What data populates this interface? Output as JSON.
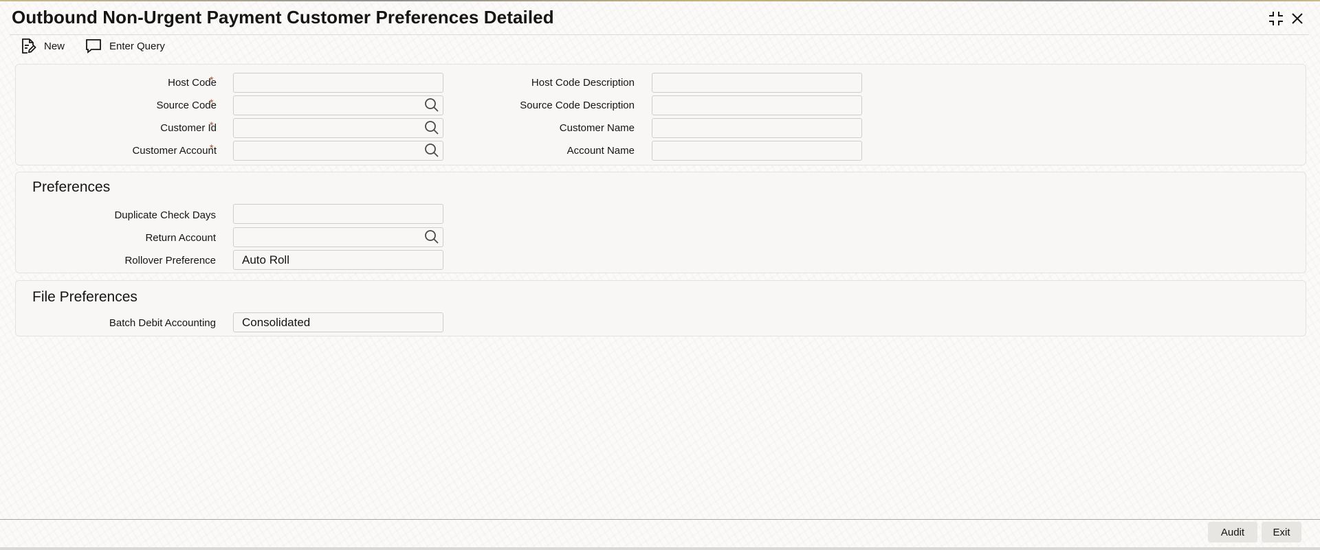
{
  "window": {
    "title": "Outbound Non-Urgent Payment Customer Preferences Detailed",
    "maximize_icon": "expand-corners-icon",
    "close_icon": "close-icon"
  },
  "toolbar": {
    "new_label": "New",
    "new_icon": "new-document-icon",
    "query_label": "Enter Query",
    "query_icon": "speech-bubble-icon"
  },
  "header_section": {
    "required_marker": "*",
    "host_code": {
      "label": "Host Code",
      "value": ""
    },
    "host_code_description": {
      "label": "Host Code Description",
      "value": ""
    },
    "source_code": {
      "label": "Source Code",
      "value": ""
    },
    "source_code_description": {
      "label": "Source Code Description",
      "value": ""
    },
    "customer_id": {
      "label": "Customer Id",
      "value": ""
    },
    "customer_name": {
      "label": "Customer Name",
      "value": ""
    },
    "customer_account": {
      "label": "Customer Account",
      "value": ""
    },
    "account_name": {
      "label": "Account Name",
      "value": ""
    }
  },
  "preferences": {
    "title": "Preferences",
    "duplicate_check_days": {
      "label": "Duplicate Check Days",
      "value": ""
    },
    "return_account": {
      "label": "Return Account",
      "value": ""
    },
    "rollover_preference": {
      "label": "Rollover Preference",
      "value": "Auto Roll"
    }
  },
  "file_preferences": {
    "title": "File Preferences",
    "batch_debit_accounting": {
      "label": "Batch Debit Accounting",
      "value": "Consolidated"
    }
  },
  "footer": {
    "audit_label": "Audit",
    "exit_label": "Exit"
  },
  "colors": {
    "required": "#b14b2a",
    "panel_bg": "#f8f7f5",
    "field_border": "#cfcdc9",
    "button_bg": "#e8e6e3"
  }
}
